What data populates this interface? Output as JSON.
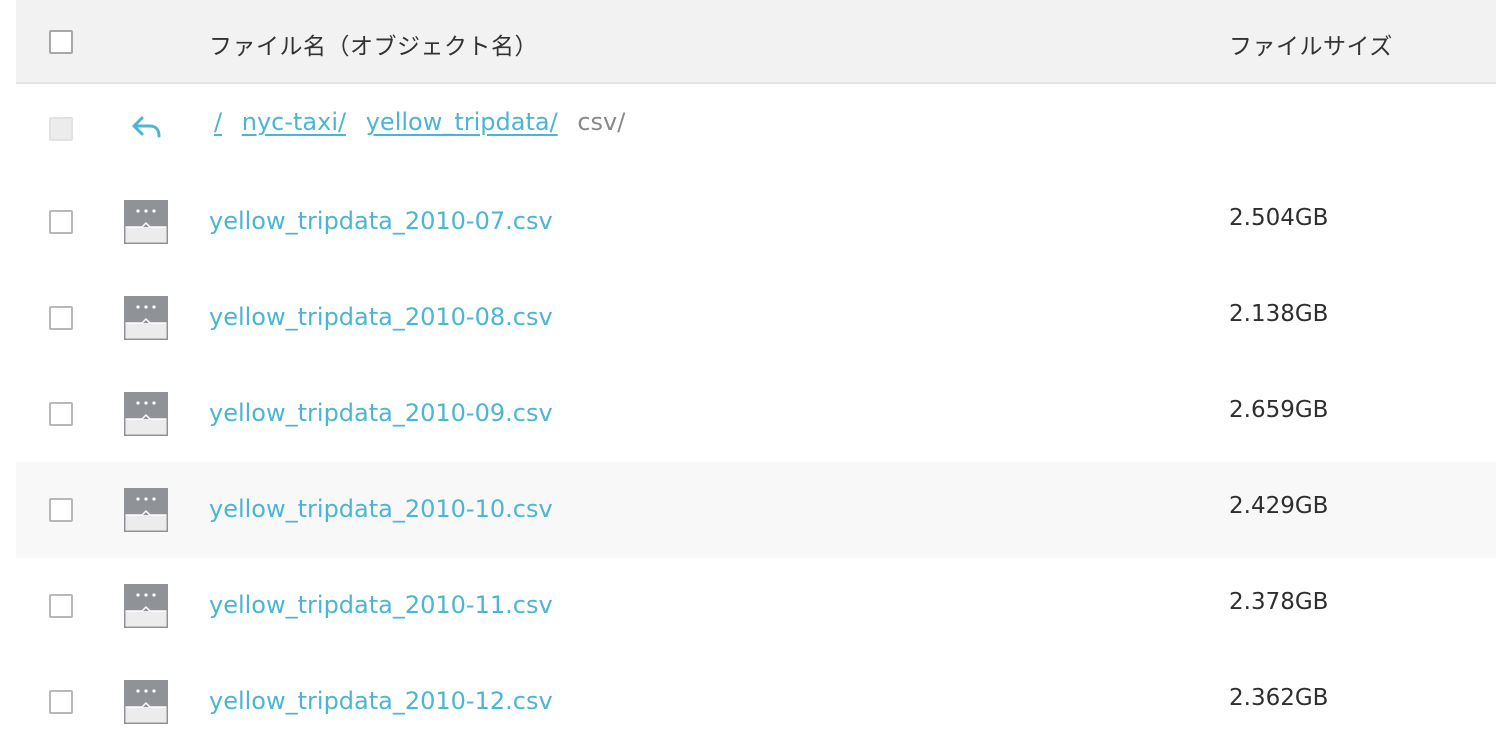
{
  "header": {
    "name_column": "ファイル名（オブジェクト名）",
    "size_column": "ファイルサイズ"
  },
  "breadcrumb": {
    "back_icon": "back-arrow-icon",
    "links": [
      "/",
      "nyc-taxi/",
      "yellow_tripdata/"
    ],
    "current": "csv/"
  },
  "files": [
    {
      "name": "yellow_tripdata_2010-07.csv",
      "size": "2.504GB",
      "icon": "file-icon"
    },
    {
      "name": "yellow_tripdata_2010-08.csv",
      "size": "2.138GB",
      "icon": "file-icon"
    },
    {
      "name": "yellow_tripdata_2010-09.csv",
      "size": "2.659GB",
      "icon": "file-icon"
    },
    {
      "name": "yellow_tripdata_2010-10.csv",
      "size": "2.429GB",
      "icon": "file-icon",
      "highlighted": true
    },
    {
      "name": "yellow_tripdata_2010-11.csv",
      "size": "2.378GB",
      "icon": "file-icon"
    },
    {
      "name": "yellow_tripdata_2010-12.csv",
      "size": "2.362GB",
      "icon": "file-icon"
    }
  ],
  "colors": {
    "link": "#4bb5d3",
    "header_bg": "#f2f2f2",
    "row_highlight_bg": "#f8f8f8",
    "icon_gray": "#8f9397"
  }
}
